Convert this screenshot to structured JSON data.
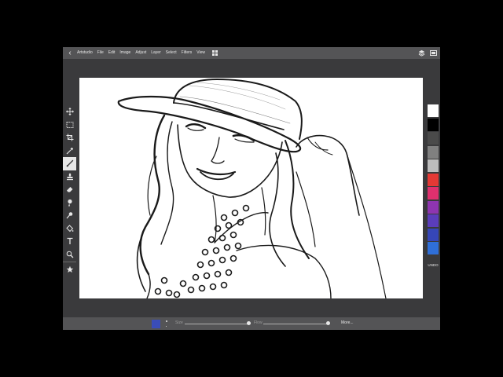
{
  "app": {
    "name": "Artstudio",
    "menu": [
      "File",
      "Edit",
      "Image",
      "Adjust",
      "Layer",
      "Select",
      "Filters",
      "View"
    ]
  },
  "icons": {
    "back": "chevron-left-icon",
    "grid": "grid-icon",
    "layers": "layers-icon",
    "panel": "panel-icon"
  },
  "tools": [
    {
      "name": "move-tool",
      "icon": "move-icon"
    },
    {
      "name": "marquee-tool",
      "icon": "marquee-icon"
    },
    {
      "name": "crop-tool",
      "icon": "crop-icon"
    },
    {
      "name": "eyedropper-tool",
      "icon": "eyedropper-icon"
    },
    {
      "name": "brush-tool",
      "icon": "brush-icon",
      "active": true
    },
    {
      "name": "stamp-tool",
      "icon": "stamp-icon"
    },
    {
      "name": "eraser-tool",
      "icon": "eraser-icon"
    },
    {
      "name": "smudge-tool",
      "icon": "smudge-icon"
    },
    {
      "name": "dodge-tool",
      "icon": "dodge-icon"
    },
    {
      "name": "fill-tool",
      "icon": "fill-bucket-icon"
    },
    {
      "name": "text-tool",
      "icon": "text-icon"
    },
    {
      "name": "zoom-tool",
      "icon": "zoom-icon"
    },
    {
      "name": "favorites-tool",
      "icon": "star-icon"
    }
  ],
  "swatches": [
    "#ffffff",
    "#000000",
    "#4a4a4a",
    "#808080",
    "#bdbdbd",
    "#e53935",
    "#e0306e",
    "#8e35b0",
    "#5b3dbb",
    "#3646b8",
    "#2f6fd8"
  ],
  "undo_label": "UNDO",
  "bottom": {
    "current_color": "#3a4db8",
    "size_label": "Size",
    "flow_label": "Flow",
    "size_value": 1.0,
    "flow_value": 1.0,
    "more_label": "More..."
  }
}
